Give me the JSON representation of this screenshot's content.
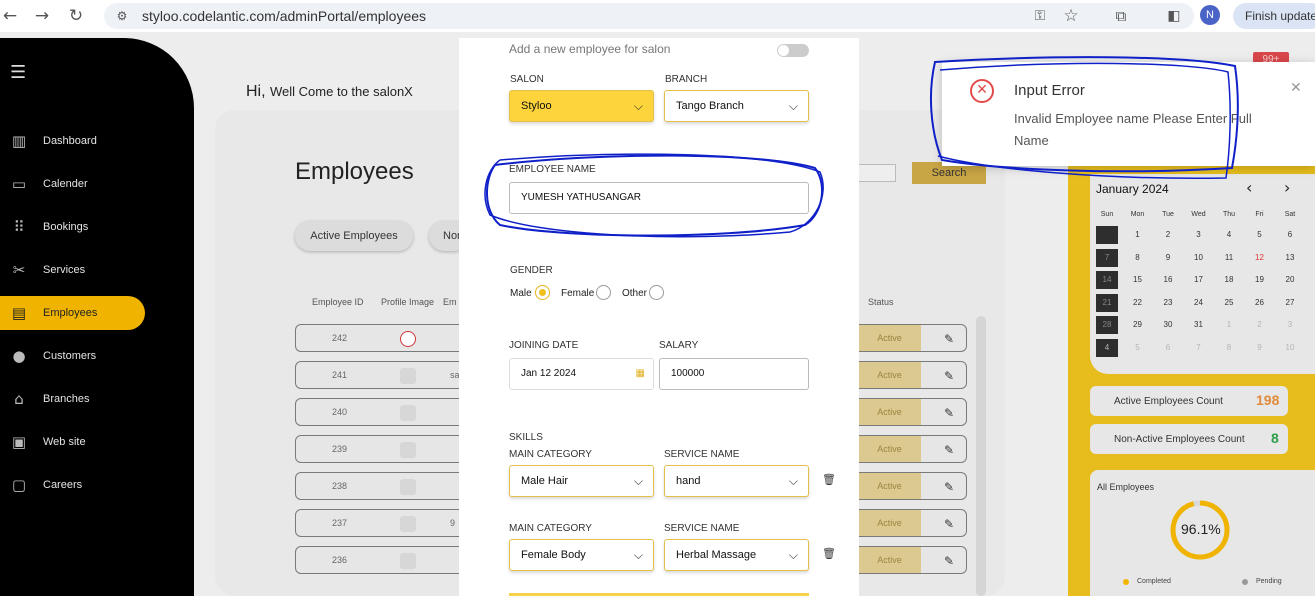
{
  "browser": {
    "url": "styloo.codelantic.com/adminPortal/employees",
    "finish_update": "Finish update",
    "profile_initial": "N",
    "icons": [
      "back-icon",
      "forward-icon",
      "reload-icon",
      "site-settings-icon",
      "key-icon",
      "bookmark-star-icon",
      "extensions-icon",
      "sidebar-icon"
    ]
  },
  "sidebar": {
    "items": [
      {
        "label": "Dashboard",
        "icon": "dashboard-icon"
      },
      {
        "label": "Calender",
        "icon": "calendar-icon"
      },
      {
        "label": "Bookings",
        "icon": "grid-icon"
      },
      {
        "label": "Services",
        "icon": "scissors-icon"
      },
      {
        "label": "Employees",
        "icon": "id-card-icon"
      },
      {
        "label": "Customers",
        "icon": "person-icon"
      },
      {
        "label": "Branches",
        "icon": "store-icon"
      },
      {
        "label": "Web site",
        "icon": "monitor-icon"
      },
      {
        "label": "Careers",
        "icon": "briefcase-icon"
      }
    ],
    "active": "Employees"
  },
  "page": {
    "greeting_hi": "Hi,",
    "greeting_rest": "Well Come to the salonX",
    "title": "Employees",
    "search_button": "Search",
    "tab_active": "Active Employees",
    "tab_other": "Non",
    "columns": [
      "Employee ID",
      "Profile Image",
      "Em",
      "Status"
    ],
    "rows": [
      {
        "id": "242",
        "status": "Active",
        "name_frag": ""
      },
      {
        "id": "241",
        "status": "Active",
        "name_frag": "sa"
      },
      {
        "id": "240",
        "status": "Active",
        "name_frag": ""
      },
      {
        "id": "239",
        "status": "Active",
        "name_frag": ""
      },
      {
        "id": "238",
        "status": "Active",
        "name_frag": ""
      },
      {
        "id": "237",
        "status": "Active",
        "name_frag": "9"
      },
      {
        "id": "236",
        "status": "Active",
        "name_frag": ""
      }
    ],
    "notif_badge": "99+"
  },
  "calendar": {
    "month": "January 2024",
    "weekdays": [
      "Sun",
      "Mon",
      "Tue",
      "Wed",
      "Thu",
      "Fri",
      "Sat"
    ],
    "weeks": [
      [
        "",
        "1",
        "2",
        "3",
        "4",
        "5",
        "6"
      ],
      [
        "7",
        "8",
        "9",
        "10",
        "11",
        "12",
        "13"
      ],
      [
        "14",
        "15",
        "16",
        "17",
        "18",
        "19",
        "20"
      ],
      [
        "21",
        "22",
        "23",
        "24",
        "25",
        "26",
        "27"
      ],
      [
        "28",
        "29",
        "30",
        "31",
        "1",
        "2",
        "3"
      ],
      [
        "4",
        "5",
        "6",
        "7",
        "8",
        "9",
        "10"
      ]
    ],
    "highlight_day": "12"
  },
  "stats": {
    "active_label": "Active Employees Count",
    "active_value": "198",
    "inactive_label": "Non-Active Employees Count",
    "inactive_value": "8",
    "all_title": "All Employees",
    "percent": "96.1%",
    "percent_value": 96.1,
    "legend_completed": "Completed",
    "legend_pending": "Pending"
  },
  "modal": {
    "heading": "Add a new employee for salon",
    "salon_label": "SALON",
    "salon_value": "Styloo",
    "branch_label": "BRANCH",
    "branch_value": "Tango Branch",
    "name_label": "EMPLOYEE NAME",
    "name_value": "YUMESH YATHUSANGAR",
    "gender_label": "GENDER",
    "gender_options": [
      "Male",
      "Female",
      "Other"
    ],
    "gender_selected": "Male",
    "joining_label": "JOINING DATE",
    "joining_value": "Jan 12 2024",
    "salary_label": "SALARY",
    "salary_value": "100000",
    "skills_label": "SKILLS",
    "skills": [
      {
        "cat_label": "MAIN CATEGORY",
        "cat_value": "Male Hair",
        "svc_label": "SERVICE NAME",
        "svc_value": "hand"
      },
      {
        "cat_label": "MAIN CATEGORY",
        "cat_value": "Female Body",
        "svc_label": "SERVICE NAME",
        "svc_value": "Herbal Massage"
      }
    ]
  },
  "toast": {
    "title": "Input Error",
    "message": "Invalid Employee name Please Enter Full Name"
  },
  "colors": {
    "accent": "#f0b400",
    "error": "#e34b4b",
    "annotation": "#1020c8"
  }
}
